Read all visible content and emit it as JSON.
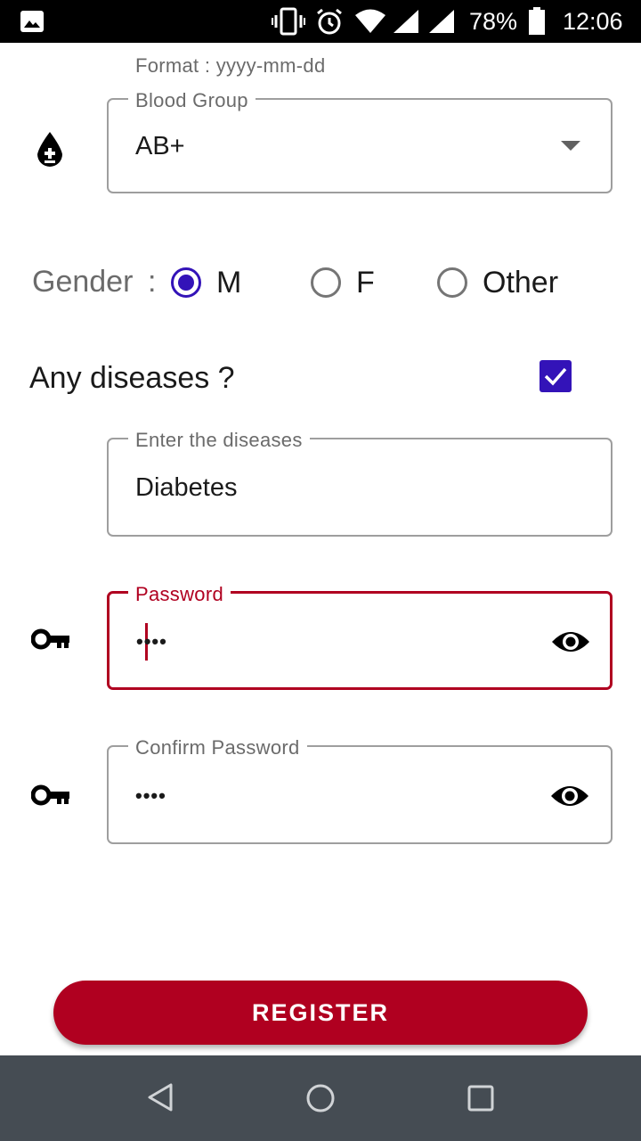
{
  "status_bar": {
    "battery": "78%",
    "time": "12:06"
  },
  "dob": {
    "helper": "Format : yyyy-mm-dd"
  },
  "blood_group": {
    "label": "Blood Group",
    "value": "AB+"
  },
  "gender": {
    "label": "Gender",
    "separator": ":",
    "options": [
      {
        "label": "M",
        "selected": true
      },
      {
        "label": "F",
        "selected": false
      },
      {
        "label": "Other",
        "selected": false
      }
    ]
  },
  "diseases": {
    "question": "Any diseases ?",
    "checked": true,
    "label": "Enter the diseases",
    "value": "Diabetes"
  },
  "password": {
    "label": "Password",
    "value": "••••"
  },
  "confirm_password": {
    "label": "Confirm Password",
    "value": "••••"
  },
  "register": {
    "label": "REGISTER"
  },
  "colors": {
    "primary": "#b00020",
    "accent": "#3313b8",
    "navbar": "#454c53"
  },
  "icons": [
    "image-icon",
    "vibrate-icon",
    "alarm-icon",
    "wifi-icon",
    "signal-icon",
    "battery-icon",
    "blood-drop-icon",
    "dropdown-arrow-icon",
    "key-icon",
    "eye-icon",
    "back-icon",
    "home-icon",
    "recents-icon"
  ]
}
